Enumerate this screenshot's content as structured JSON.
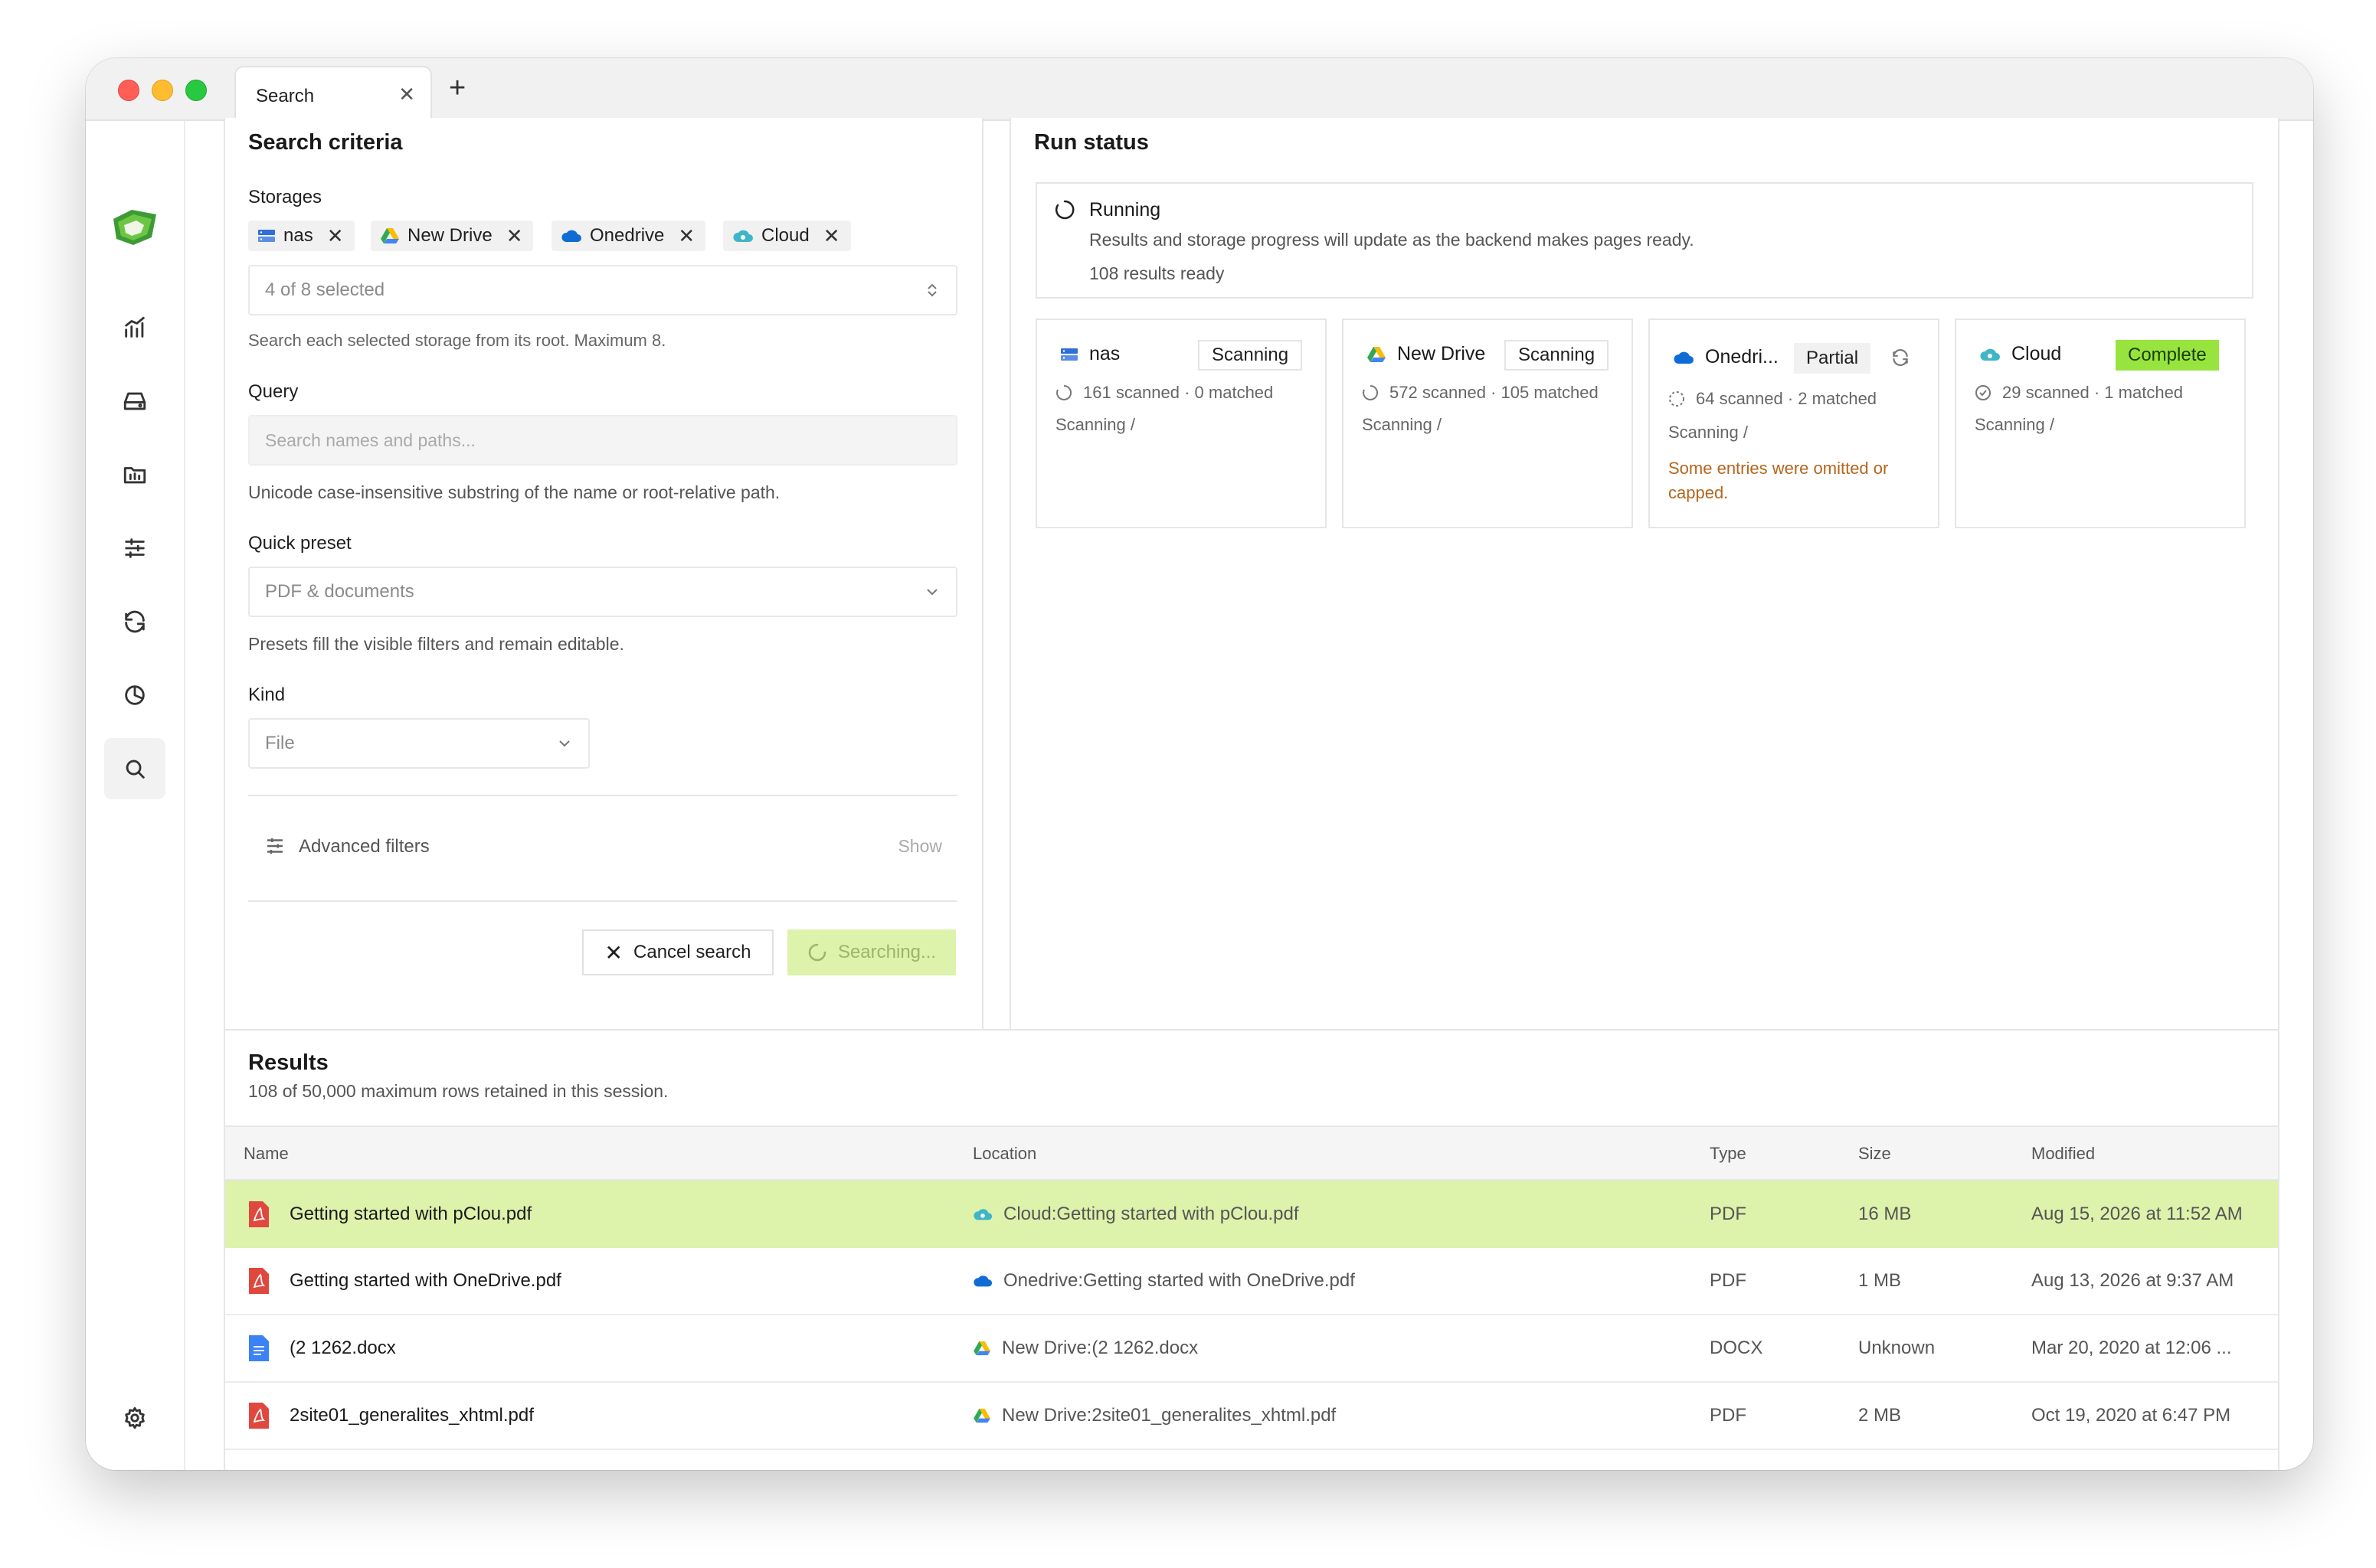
{
  "tab": {
    "title": "Search"
  },
  "criteria": {
    "title": "Search criteria",
    "storages_label": "Storages",
    "chips": [
      {
        "label": "nas",
        "icon": "server-icon"
      },
      {
        "label": "New Drive",
        "icon": "google-drive-icon"
      },
      {
        "label": "Onedrive",
        "icon": "onedrive-cloud-icon"
      },
      {
        "label": "Cloud",
        "icon": "pcloud-icon"
      }
    ],
    "storage_select": "4 of 8 selected",
    "storage_hint": "Search each selected storage from its root. Maximum 8.",
    "query_label": "Query",
    "query_placeholder": "Search names and paths...",
    "query_hint": "Unicode case-insensitive substring of the name or root-relative path.",
    "preset_label": "Quick preset",
    "preset_value": "PDF & documents",
    "preset_hint": "Presets fill the visible filters and remain editable.",
    "kind_label": "Kind",
    "kind_value": "File",
    "advanced_label": "Advanced filters",
    "advanced_toggle": "Show",
    "cancel_label": "Cancel search",
    "search_label": "Searching..."
  },
  "run_status": {
    "title": "Run status",
    "state": "Running",
    "description": "Results and storage progress will update as the backend makes pages ready.",
    "ready": "108 results ready",
    "cards": [
      {
        "name": "nas",
        "badge": "Scanning",
        "stats": "161 scanned · 0 matched",
        "sub": "Scanning /"
      },
      {
        "name": "New Drive",
        "badge": "Scanning",
        "stats": "572 scanned · 105 matched",
        "sub": "Scanning /"
      },
      {
        "name": "Onedri...",
        "badge": "Partial",
        "stats": "64 scanned · 2 matched",
        "sub": "Scanning /",
        "warning": "Some entries were omitted or capped."
      },
      {
        "name": "Cloud",
        "badge": "Complete",
        "stats": "29 scanned · 1 matched",
        "sub": "Scanning /"
      }
    ]
  },
  "results": {
    "title": "Results",
    "subtitle": "108 of 50,000 maximum rows retained in this session.",
    "columns": [
      "Name",
      "Location",
      "Type",
      "Size",
      "Modified"
    ],
    "rows": [
      {
        "name": "Getting started with pClou.pdf",
        "location": "Cloud:Getting started with pClou.pdf",
        "type": "PDF",
        "size": "16 MB",
        "modified": "Aug 15, 2026 at 11:52 AM"
      },
      {
        "name": "Getting started with OneDrive.pdf",
        "location": "Onedrive:Getting started with OneDrive.pdf",
        "type": "PDF",
        "size": "1 MB",
        "modified": "Aug 13, 2026 at 9:37 AM"
      },
      {
        "name": "(2 1262.docx",
        "location": "New Drive:(2 1262.docx",
        "type": "DOCX",
        "size": "Unknown",
        "modified": "Mar 20, 2020 at 12:06 ..."
      },
      {
        "name": "2site01_generalites_xhtml.pdf",
        "location": "New Drive:2site01_generalites_xhtml.pdf",
        "type": "PDF",
        "size": "2 MB",
        "modified": "Oct 19, 2020 at 6:47 PM"
      }
    ]
  },
  "colors": {
    "accent": "#98e43f",
    "selected_row": "#ddf2ab",
    "warning": "#b5651d",
    "pdf": "#e0483e",
    "docx": "#3b82f6"
  }
}
